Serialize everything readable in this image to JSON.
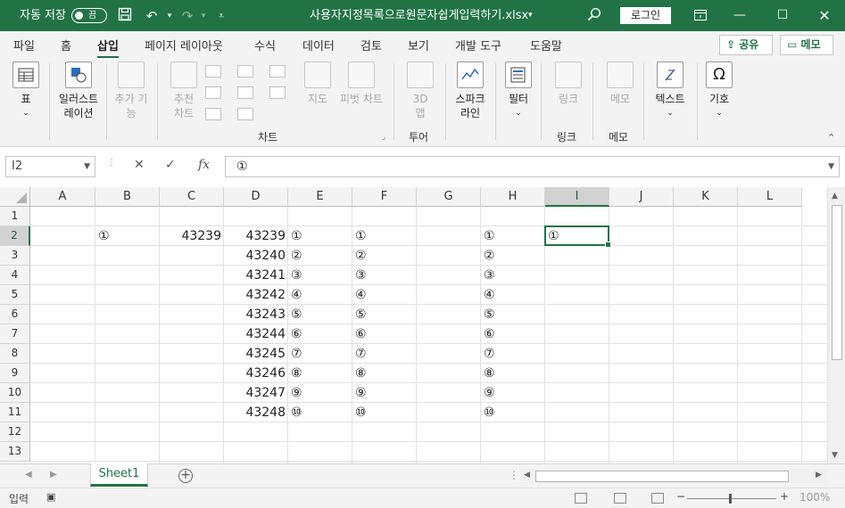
{
  "titlebar": {
    "autosave_label": "자동 저장",
    "autosave_state": "끔",
    "filename": "사용자지정목록으로원문자쉽게입력하기.xlsx",
    "login": "로그인",
    "accent": "#217346"
  },
  "tabs": [
    "파일",
    "홈",
    "삽입",
    "페이지 레이아웃",
    "수식",
    "데이터",
    "검토",
    "보기",
    "개발 도구",
    "도움말"
  ],
  "active_tab": "삽입",
  "share_label": "공유",
  "memo_label": "메모",
  "ribbon": {
    "table": "표",
    "illustration_1": "일러스트",
    "illustration_2": "레이션",
    "addin_1": "추가 기",
    "addin_2": "능",
    "rec_chart_1": "추천",
    "rec_chart_2": "차트",
    "map": "지도",
    "pivot_chart": "피벗 차트",
    "map3d_1": "3D",
    "map3d_2": "맵",
    "sparkline_1": "스파크",
    "sparkline_2": "라인",
    "filter": "필터",
    "link": "링크",
    "memo": "메모",
    "text": "텍스트",
    "symbol": "기호",
    "group_chart": "차트",
    "group_tour": "투어",
    "group_link": "링크",
    "group_memo": "메모"
  },
  "formula_bar": {
    "name_box": "I2",
    "content": "①"
  },
  "columns": [
    "A",
    "B",
    "C",
    "D",
    "E",
    "F",
    "G",
    "H",
    "I",
    "J",
    "K",
    "L"
  ],
  "selected_column": "I",
  "rows": [
    "1",
    "2",
    "3",
    "4",
    "5",
    "6",
    "7",
    "8",
    "9",
    "10",
    "11",
    "12",
    "13"
  ],
  "selected_row": "2",
  "cells": {
    "B2": "①",
    "C2": "43239",
    "D": [
      "43239",
      "43240",
      "43241",
      "43242",
      "43243",
      "43244",
      "43245",
      "43246",
      "43247",
      "43248"
    ],
    "E": [
      "①",
      "②",
      "③",
      "④",
      "⑤",
      "⑥",
      "⑦",
      "⑧",
      "⑨",
      "⑩"
    ],
    "F": [
      "①",
      "②",
      "③",
      "④",
      "⑤",
      "⑥",
      "⑦",
      "⑧",
      "⑨",
      "⑩"
    ],
    "H": [
      "①",
      "②",
      "③",
      "④",
      "⑤",
      "⑥",
      "⑦",
      "⑧",
      "⑨",
      "⑩"
    ],
    "I2": "①"
  },
  "sheet_tab": "Sheet1",
  "status": {
    "mode": "입력",
    "zoom": "100%"
  }
}
